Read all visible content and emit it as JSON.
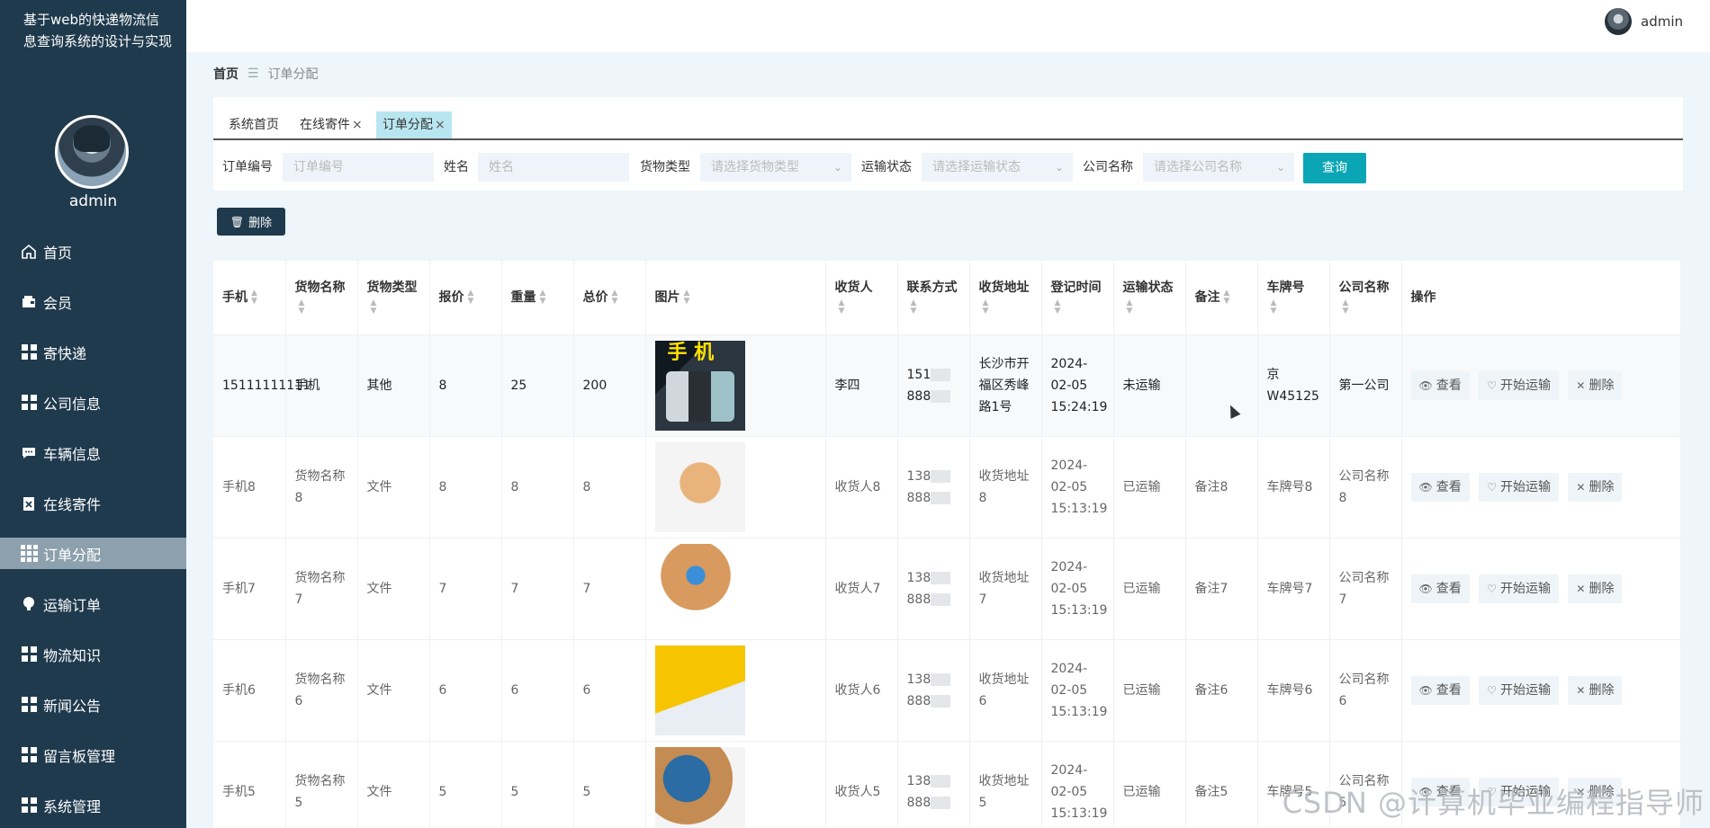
{
  "app": {
    "title": "基于web的快递物流信息查询系统的设计与实现",
    "username": "admin"
  },
  "sidebar": {
    "items": [
      {
        "label": "首页",
        "icon": "home-icon"
      },
      {
        "label": "会员",
        "icon": "wallet-icon"
      },
      {
        "label": "寄快递",
        "icon": "grid-icon"
      },
      {
        "label": "公司信息",
        "icon": "grid-icon"
      },
      {
        "label": "车辆信息",
        "icon": "chat-icon"
      },
      {
        "label": "在线寄件",
        "icon": "clipboard-x-icon"
      },
      {
        "label": "订单分配",
        "icon": "grid9-icon",
        "active": true
      },
      {
        "label": "运输订单",
        "icon": "bulb-icon"
      },
      {
        "label": "物流知识",
        "icon": "grid-icon"
      },
      {
        "label": "新闻公告",
        "icon": "grid-icon"
      },
      {
        "label": "留言板管理",
        "icon": "grid-icon"
      },
      {
        "label": "系统管理",
        "icon": "grid-icon"
      }
    ]
  },
  "breadcrumb": {
    "home": "首页",
    "current": "订单分配"
  },
  "tabs": [
    {
      "label": "系统首页"
    },
    {
      "label": "在线寄件",
      "close": "×"
    },
    {
      "label": "订单分配",
      "close": "×"
    }
  ],
  "filters": {
    "order_no": {
      "label": "订单编号",
      "placeholder": "订单编号"
    },
    "name": {
      "label": "姓名",
      "placeholder": "姓名"
    },
    "goods_type": {
      "label": "货物类型",
      "placeholder": "请选择货物类型"
    },
    "transport_status": {
      "label": "运输状态",
      "placeholder": "请选择运输状态"
    },
    "company": {
      "label": "公司名称",
      "placeholder": "请选择公司名称"
    },
    "query_label": "查询"
  },
  "toolbar": {
    "delete_label": "删除"
  },
  "table": {
    "columns": [
      "手机",
      "货物名称",
      "货物类型",
      "报价",
      "重量",
      "总价",
      "图片",
      "收货人",
      "联系方式",
      "收货地址",
      "登记时间",
      "运输状态",
      "备注",
      "车牌号",
      "公司名称",
      "操作"
    ],
    "actions": {
      "view": "查看",
      "start": "开始运输",
      "delete": "删除"
    },
    "rows": [
      {
        "phone": "15111111111",
        "goods_name": "手机",
        "goods_type": "其他",
        "quote": "8",
        "weight": "25",
        "total": "200",
        "image": "phone-image",
        "receiver": "李四",
        "contact_a": "151",
        "contact_b": "888",
        "address": "长沙市开福区秀峰路1号",
        "time": "2024-02-05 15:24:19",
        "status": "未运输",
        "remark": "",
        "plate": "京W45125",
        "company": "第一公司"
      },
      {
        "phone": "手机8",
        "goods_name": "货物名称8",
        "goods_type": "文件",
        "quote": "8",
        "weight": "8",
        "total": "8",
        "image": "courier-image",
        "receiver": "收货人8",
        "contact_a": "138",
        "contact_b": "888",
        "address": "收货地址8",
        "time": "2024-02-05 15:13:19",
        "status": "已运输",
        "remark": "备注8",
        "plate": "车牌号8",
        "company": "公司名称8"
      },
      {
        "phone": "手机7",
        "goods_name": "货物名称7",
        "goods_type": "文件",
        "quote": "7",
        "weight": "7",
        "total": "7",
        "image": "boxes-image",
        "receiver": "收货人7",
        "contact_a": "138",
        "contact_b": "888",
        "address": "收货地址7",
        "time": "2024-02-05 15:13:19",
        "status": "已运输",
        "remark": "备注7",
        "plate": "车牌号7",
        "company": "公司名称7"
      },
      {
        "phone": "手机6",
        "goods_name": "货物名称6",
        "goods_type": "文件",
        "quote": "6",
        "weight": "6",
        "total": "6",
        "image": "tickets-image",
        "receiver": "收货人6",
        "contact_a": "138",
        "contact_b": "888",
        "address": "收货地址6",
        "time": "2024-02-05 15:13:19",
        "status": "已运输",
        "remark": "备注6",
        "plate": "车牌号6",
        "company": "公司名称6"
      },
      {
        "phone": "手机5",
        "goods_name": "货物名称5",
        "goods_type": "文件",
        "quote": "5",
        "weight": "5",
        "total": "5",
        "image": "globe-image",
        "receiver": "收货人5",
        "contact_a": "138",
        "contact_b": "888",
        "address": "收货地址5",
        "time": "2024-02-05 15:13:19",
        "status": "已运输",
        "remark": "备注5",
        "plate": "车牌号5",
        "company": "公司名称5"
      }
    ]
  },
  "watermark": "CSDN @计算机毕业编程指导师"
}
